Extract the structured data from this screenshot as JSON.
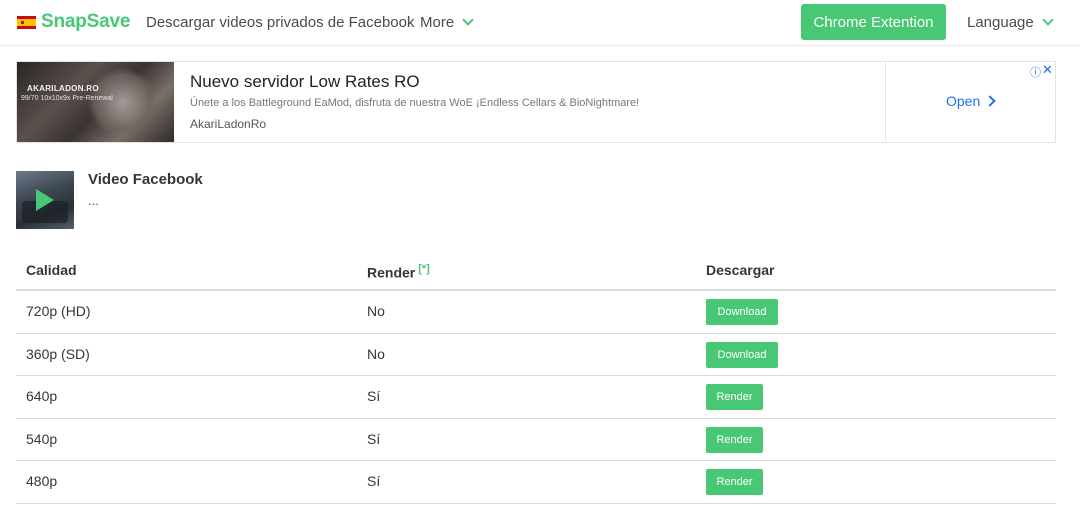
{
  "navbar": {
    "brand": "SnapSave",
    "private_link": "Descargar videos privados de Facebook",
    "more": "More",
    "chrome_button": "Chrome Extention",
    "language": "Language"
  },
  "ad": {
    "image_text_1": "AKARILADON.RO",
    "image_text_2": "99/70 10x10x9x Pre-Renewal",
    "title": "Nuevo servidor Low Rates RO",
    "description": "Únete a los Battleground EaMod, disfruta de nuestra WoE ¡Endless Cellars & BioNightmare!",
    "source": "AkariLadonRo",
    "open_label": "Open",
    "info_icon": "ⓘ",
    "close_icon": "✕"
  },
  "video": {
    "title": "Video Facebook",
    "subtitle": "..."
  },
  "table": {
    "headers": {
      "quality": "Calidad",
      "render": "Render",
      "render_note": "[*]",
      "download": "Descargar"
    },
    "rows": [
      {
        "quality": "720p (HD)",
        "render": "No",
        "action": "Download",
        "type": "download"
      },
      {
        "quality": "360p (SD)",
        "render": "No",
        "action": "Download",
        "type": "download"
      },
      {
        "quality": "640p",
        "render": "Sí",
        "action": "Render",
        "type": "render"
      },
      {
        "quality": "540p",
        "render": "Sí",
        "action": "Render",
        "type": "render"
      },
      {
        "quality": "480p",
        "render": "Sí",
        "action": "Render",
        "type": "render"
      }
    ]
  },
  "colors": {
    "accent": "#48c774",
    "link_blue": "#1a73e8"
  }
}
